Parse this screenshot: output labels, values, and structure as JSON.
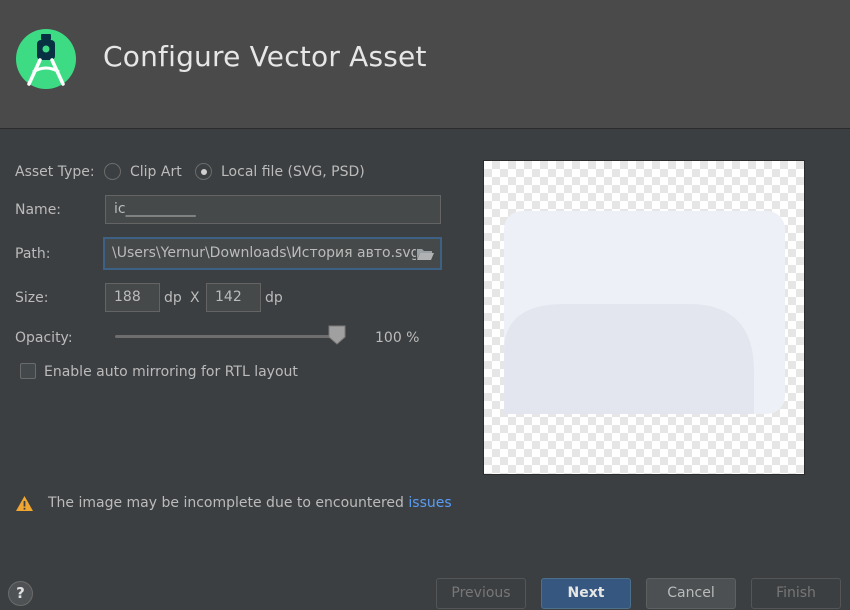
{
  "header": {
    "title": "Configure Vector Asset"
  },
  "form": {
    "asset_type_label": "Asset Type:",
    "clip_art_label": "Clip Art",
    "local_file_label": "Local file (SVG, PSD)",
    "name_label": "Name:",
    "name_value": "ic__________",
    "path_label": "Path:",
    "path_value": "\\Users\\Yernur\\Downloads\\История авто.svg",
    "size_label": "Size:",
    "width_value": "188",
    "height_value": "142",
    "dp_unit": "dp",
    "x_separator": "X",
    "opacity_label": "Opacity:",
    "opacity_value": "100 %",
    "opacity_fraction": 1.0,
    "mirroring_label": "Enable auto mirroring for RTL layout",
    "mirroring_checked": false,
    "selected_asset_type": "local_file"
  },
  "warning": {
    "text": "The image may be incomplete due to encountered ",
    "link": "issues"
  },
  "buttons": {
    "help": "?",
    "previous": "Previous",
    "next": "Next",
    "cancel": "Cancel",
    "finish": "Finish"
  },
  "colors": {
    "accent": "#365880",
    "link": "#589df6",
    "warning": "#f0a732",
    "logo_green": "#3ddc84"
  }
}
